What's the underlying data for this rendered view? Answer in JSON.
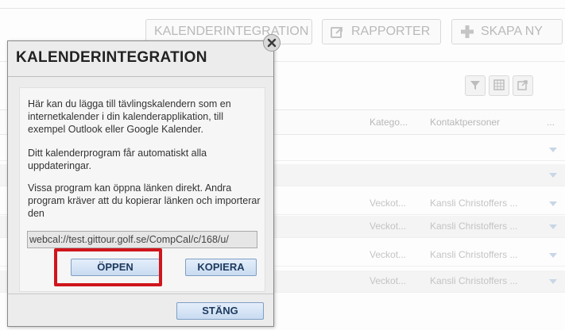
{
  "toolbar": {
    "calendar_label": "KALENDERINTEGRATION",
    "reports_label": "RAPPORTER",
    "create_label": "SKAPA NY"
  },
  "grid": {
    "columns": [
      "Katego...",
      "Kontaktpersoner",
      "..."
    ],
    "rows": [
      {
        "category": "",
        "contact": ""
      },
      {
        "category": "",
        "contact": ""
      },
      {
        "category": "Veckot...",
        "contact": "Kansli Christoffers ..."
      },
      {
        "category": "Veckot...",
        "contact": "Kansli Christoffers ..."
      },
      {
        "category": "Veckot...",
        "contact": "Kansli Christoffers ..."
      },
      {
        "category": "Veckot...",
        "contact": "Kansli Christoffers ..."
      }
    ]
  },
  "dialog": {
    "title": "KALENDERINTEGRATION",
    "para1": "Här kan du lägga till tävlingskalendern som en internetkalender i din kalenderapplikation, till exempel Outlook eller Google Kalender.",
    "para2": "Ditt kalenderprogram får automatiskt alla uppdateringar.",
    "para3": "Vissa program kan öppna länken direkt. Andra program kräver att du kopierar länken och importerar den",
    "url": "webcal://test.gittour.golf.se/CompCal/c/168/u/",
    "open_label": "ÖPPEN",
    "copy_label": "KOPIERA",
    "close_label": "STÄNG"
  },
  "colors": {
    "highlight": "#d0151c",
    "button_text": "#1d3a5f"
  },
  "icons": [
    "share-icon",
    "plus-icon",
    "filter-icon",
    "grid-icon",
    "export-icon",
    "close-icon",
    "dropdown-caret-icon"
  ]
}
